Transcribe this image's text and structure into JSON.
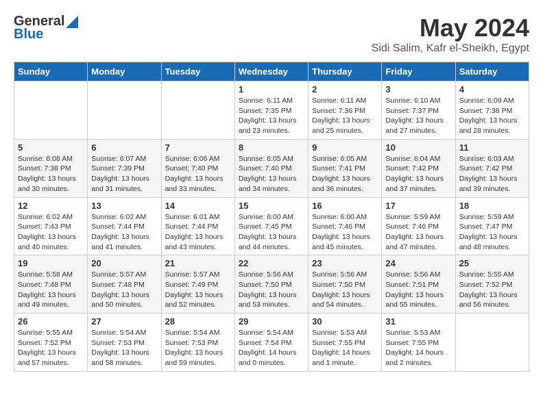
{
  "logo": {
    "general": "General",
    "blue": "Blue"
  },
  "title": "May 2024",
  "location": "Sidi Salim, Kafr el-Sheikh, Egypt",
  "headers": [
    "Sunday",
    "Monday",
    "Tuesday",
    "Wednesday",
    "Thursday",
    "Friday",
    "Saturday"
  ],
  "weeks": [
    [
      {
        "day": "",
        "info": ""
      },
      {
        "day": "",
        "info": ""
      },
      {
        "day": "",
        "info": ""
      },
      {
        "day": "1",
        "info": "Sunrise: 6:11 AM\nSunset: 7:35 PM\nDaylight: 13 hours\nand 23 minutes."
      },
      {
        "day": "2",
        "info": "Sunrise: 6:11 AM\nSunset: 7:36 PM\nDaylight: 13 hours\nand 25 minutes."
      },
      {
        "day": "3",
        "info": "Sunrise: 6:10 AM\nSunset: 7:37 PM\nDaylight: 13 hours\nand 27 minutes."
      },
      {
        "day": "4",
        "info": "Sunrise: 6:09 AM\nSunset: 7:38 PM\nDaylight: 13 hours\nand 28 minutes."
      }
    ],
    [
      {
        "day": "5",
        "info": "Sunrise: 6:08 AM\nSunset: 7:38 PM\nDaylight: 13 hours\nand 30 minutes."
      },
      {
        "day": "6",
        "info": "Sunrise: 6:07 AM\nSunset: 7:39 PM\nDaylight: 13 hours\nand 31 minutes."
      },
      {
        "day": "7",
        "info": "Sunrise: 6:06 AM\nSunset: 7:40 PM\nDaylight: 13 hours\nand 33 minutes."
      },
      {
        "day": "8",
        "info": "Sunrise: 6:05 AM\nSunset: 7:40 PM\nDaylight: 13 hours\nand 34 minutes."
      },
      {
        "day": "9",
        "info": "Sunrise: 6:05 AM\nSunset: 7:41 PM\nDaylight: 13 hours\nand 36 minutes."
      },
      {
        "day": "10",
        "info": "Sunrise: 6:04 AM\nSunset: 7:42 PM\nDaylight: 13 hours\nand 37 minutes."
      },
      {
        "day": "11",
        "info": "Sunrise: 6:03 AM\nSunset: 7:42 PM\nDaylight: 13 hours\nand 39 minutes."
      }
    ],
    [
      {
        "day": "12",
        "info": "Sunrise: 6:02 AM\nSunset: 7:43 PM\nDaylight: 13 hours\nand 40 minutes."
      },
      {
        "day": "13",
        "info": "Sunrise: 6:02 AM\nSunset: 7:44 PM\nDaylight: 13 hours\nand 41 minutes."
      },
      {
        "day": "14",
        "info": "Sunrise: 6:01 AM\nSunset: 7:44 PM\nDaylight: 13 hours\nand 43 minutes."
      },
      {
        "day": "15",
        "info": "Sunrise: 6:00 AM\nSunset: 7:45 PM\nDaylight: 13 hours\nand 44 minutes."
      },
      {
        "day": "16",
        "info": "Sunrise: 6:00 AM\nSunset: 7:46 PM\nDaylight: 13 hours\nand 45 minutes."
      },
      {
        "day": "17",
        "info": "Sunrise: 5:59 AM\nSunset: 7:46 PM\nDaylight: 13 hours\nand 47 minutes."
      },
      {
        "day": "18",
        "info": "Sunrise: 5:59 AM\nSunset: 7:47 PM\nDaylight: 13 hours\nand 48 minutes."
      }
    ],
    [
      {
        "day": "19",
        "info": "Sunrise: 5:58 AM\nSunset: 7:48 PM\nDaylight: 13 hours\nand 49 minutes."
      },
      {
        "day": "20",
        "info": "Sunrise: 5:57 AM\nSunset: 7:48 PM\nDaylight: 13 hours\nand 50 minutes."
      },
      {
        "day": "21",
        "info": "Sunrise: 5:57 AM\nSunset: 7:49 PM\nDaylight: 13 hours\nand 52 minutes."
      },
      {
        "day": "22",
        "info": "Sunrise: 5:56 AM\nSunset: 7:50 PM\nDaylight: 13 hours\nand 53 minutes."
      },
      {
        "day": "23",
        "info": "Sunrise: 5:56 AM\nSunset: 7:50 PM\nDaylight: 13 hours\nand 54 minutes."
      },
      {
        "day": "24",
        "info": "Sunrise: 5:56 AM\nSunset: 7:51 PM\nDaylight: 13 hours\nand 55 minutes."
      },
      {
        "day": "25",
        "info": "Sunrise: 5:55 AM\nSunset: 7:52 PM\nDaylight: 13 hours\nand 56 minutes."
      }
    ],
    [
      {
        "day": "26",
        "info": "Sunrise: 5:55 AM\nSunset: 7:52 PM\nDaylight: 13 hours\nand 57 minutes."
      },
      {
        "day": "27",
        "info": "Sunrise: 5:54 AM\nSunset: 7:53 PM\nDaylight: 13 hours\nand 58 minutes."
      },
      {
        "day": "28",
        "info": "Sunrise: 5:54 AM\nSunset: 7:53 PM\nDaylight: 13 hours\nand 59 minutes."
      },
      {
        "day": "29",
        "info": "Sunrise: 5:54 AM\nSunset: 7:54 PM\nDaylight: 14 hours\nand 0 minutes."
      },
      {
        "day": "30",
        "info": "Sunrise: 5:53 AM\nSunset: 7:55 PM\nDaylight: 14 hours\nand 1 minute."
      },
      {
        "day": "31",
        "info": "Sunrise: 5:53 AM\nSunset: 7:55 PM\nDaylight: 14 hours\nand 2 minutes."
      },
      {
        "day": "",
        "info": ""
      }
    ]
  ]
}
